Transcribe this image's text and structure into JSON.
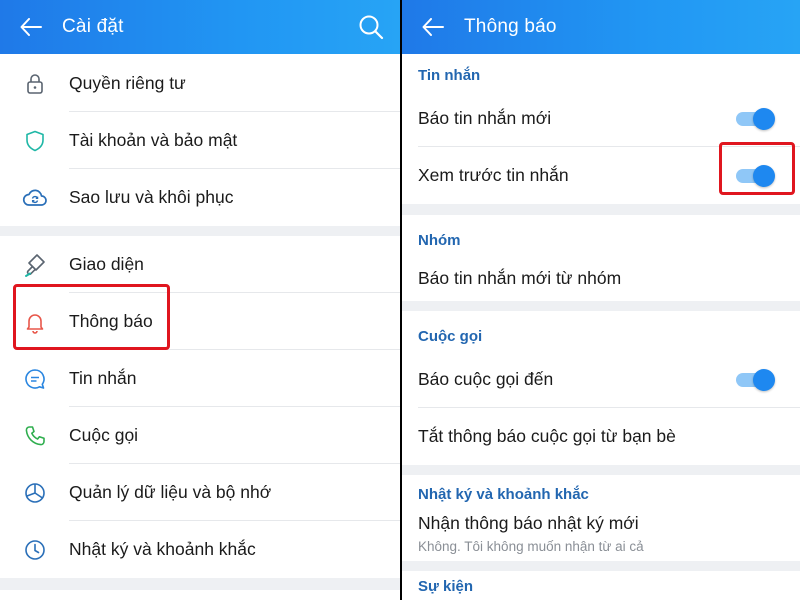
{
  "left": {
    "header": {
      "title": "Cài đặt",
      "back_icon": "arrow-left-icon",
      "search_icon": "search-icon"
    },
    "groups": [
      [
        {
          "label": "Quyền riêng tư",
          "icon": "lock-icon"
        },
        {
          "label": "Tài khoản và bảo mật",
          "icon": "shield-icon"
        },
        {
          "label": "Sao lưu và khôi phục",
          "icon": "cloud-sync-icon"
        }
      ],
      [
        {
          "label": "Giao diện",
          "icon": "paint-brush-icon"
        },
        {
          "label": "Thông báo",
          "icon": "bell-icon",
          "highlighted": true
        },
        {
          "label": "Tin nhắn",
          "icon": "chat-bubble-icon"
        },
        {
          "label": "Cuộc gọi",
          "icon": "phone-icon"
        },
        {
          "label": "Quản lý dữ liệu và bộ nhớ",
          "icon": "pie-chart-icon"
        },
        {
          "label": "Nhật ký và khoảnh khắc",
          "icon": "clock-icon"
        }
      ]
    ]
  },
  "right": {
    "header": {
      "title": "Thông báo",
      "back_icon": "arrow-left-icon"
    },
    "sections": {
      "messages": {
        "title": "Tin nhắn",
        "rows": [
          {
            "label": "Báo tin nhắn mới",
            "toggle": true
          },
          {
            "label": "Xem trước tin nhắn",
            "toggle": true,
            "highlighted": true
          }
        ]
      },
      "groups": {
        "title": "Nhóm",
        "rows": [
          {
            "label": "Báo tin nhắn mới từ nhóm"
          }
        ]
      },
      "calls": {
        "title": "Cuộc gọi",
        "rows": [
          {
            "label": "Báo cuộc gọi đến",
            "toggle": true
          },
          {
            "label": "Tắt thông báo cuộc gọi từ bạn bè"
          }
        ]
      },
      "diary": {
        "title": "Nhật ký và khoảnh khắc",
        "rows": [
          {
            "label": "Nhận thông báo nhật ký mới",
            "sublabel": "Không. Tôi không muốn nhận từ ai cả"
          }
        ]
      },
      "events": {
        "title": "Sự kiện"
      }
    }
  },
  "colors": {
    "accent": "#1e88f0",
    "highlight": "#e0161f",
    "section_title": "#2266b0"
  }
}
